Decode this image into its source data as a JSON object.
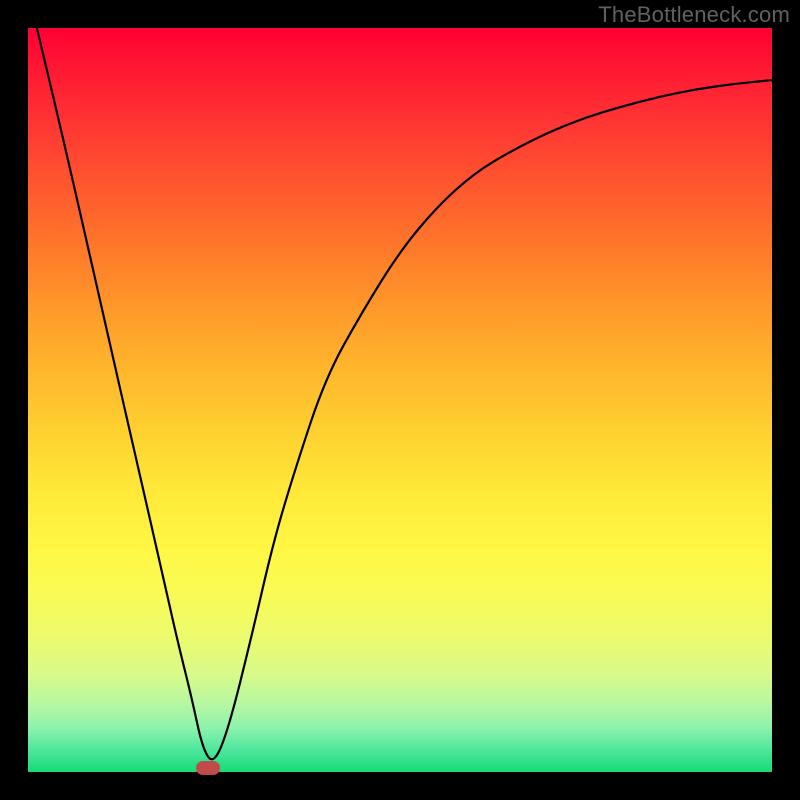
{
  "watermark": "TheBottleneck.com",
  "colors": {
    "background": "#000000",
    "curve_stroke": "#000000",
    "marker_fill": "#c24a49"
  },
  "chart_data": {
    "type": "line",
    "title": "",
    "xlabel": "",
    "ylabel": "",
    "xlim": [
      0,
      100
    ],
    "ylim": [
      0,
      100
    ],
    "grid": false,
    "legend": false,
    "plot_background": "gradient_red_to_green_vertical",
    "series": [
      {
        "name": "bottleneck-curve",
        "x": [
          0,
          5,
          10,
          15,
          18,
          20,
          22,
          23.5,
          25,
          27,
          30,
          33,
          36,
          40,
          45,
          50,
          55,
          60,
          65,
          70,
          75,
          80,
          85,
          90,
          95,
          100
        ],
        "values": [
          105,
          84,
          62,
          40,
          27,
          18,
          10,
          3,
          1,
          6,
          18,
          31,
          41,
          53,
          62,
          70,
          76,
          80.5,
          83.5,
          86,
          88,
          89.5,
          90.8,
          91.8,
          92.5,
          93
        ]
      }
    ],
    "markers": [
      {
        "name": "optimal-point",
        "x": 24.2,
        "y": 0.6,
        "shape": "rounded-rect"
      }
    ]
  }
}
